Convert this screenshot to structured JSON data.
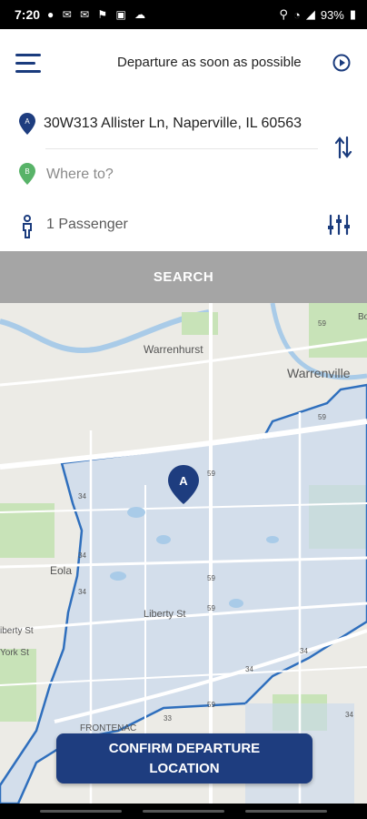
{
  "status_bar": {
    "time": "7:20",
    "battery": "93%"
  },
  "header": {
    "departure_label": "Departure as soon as possible"
  },
  "route": {
    "origin_badge": "A",
    "origin_address": "30W313 Allister Ln, Naperville, IL 60563",
    "destination_badge": "B",
    "destination_placeholder": "Where to?"
  },
  "passengers": {
    "label": "1 Passenger"
  },
  "search_button": {
    "label": "SEARCH"
  },
  "map": {
    "labels": {
      "warrenhurst": "Warrenhurst",
      "warrenville": "Warrenville",
      "eola": "Eola",
      "liberty": "Liberty St",
      "liberty_left": "iberty St",
      "york": "York St",
      "frontenac": "FRONTENAC",
      "bo": "Bo"
    },
    "route_numbers": [
      "59",
      "59",
      "59",
      "59",
      "59",
      "59",
      "34",
      "34",
      "34",
      "34",
      "34",
      "34",
      "33"
    ],
    "marker_label": "A"
  },
  "confirm_button": {
    "line1": "CONFIRM DEPARTURE",
    "line2": "LOCATION"
  },
  "colors": {
    "brand": "#1e3d7f",
    "search_bg": "#a5a5a5",
    "zone_fill": "#c9d9ec",
    "zone_border": "#2f6fbd"
  }
}
